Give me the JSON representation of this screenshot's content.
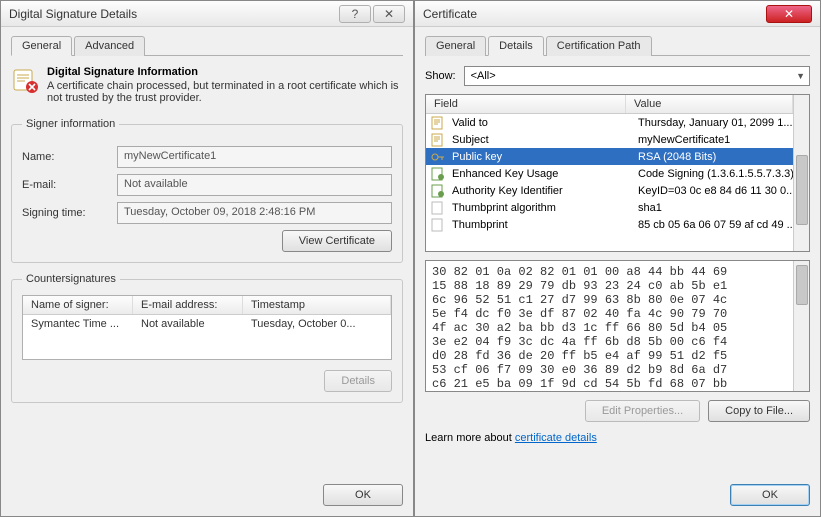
{
  "left": {
    "title": "Digital Signature Details",
    "tabs": [
      "General",
      "Advanced"
    ],
    "activeTab": 0,
    "info_title": "Digital Signature Information",
    "info_body": "A certificate chain processed, but terminated in a root certificate which is not trusted by the trust provider.",
    "signer_legend": "Signer information",
    "name_label": "Name:",
    "name_value": "myNewCertificate1",
    "email_label": "E-mail:",
    "email_value": "Not available",
    "signingtime_label": "Signing time:",
    "signingtime_value": "Tuesday,  October  09,  2018 2:48:16 PM",
    "view_cert_btn": "View Certificate",
    "counter_legend": "Countersignatures",
    "cs_headers": [
      "Name of signer:",
      "E-mail address:",
      "Timestamp"
    ],
    "cs_row": [
      "Symantec Time ...",
      "Not available",
      "Tuesday, October 0..."
    ],
    "details_btn": "Details",
    "ok_btn": "OK"
  },
  "right": {
    "title": "Certificate",
    "tabs": [
      "General",
      "Details",
      "Certification Path"
    ],
    "activeTab": 1,
    "show_label": "Show:",
    "show_value": "<All>",
    "lv_headers": [
      "Field",
      "Value"
    ],
    "rows": [
      {
        "field": "Valid to",
        "value": "Thursday, January 01, 2099 1...",
        "icon": "doc"
      },
      {
        "field": "Subject",
        "value": "myNewCertificate1",
        "icon": "doc"
      },
      {
        "field": "Public key",
        "value": "RSA (2048 Bits)",
        "icon": "key",
        "selected": true
      },
      {
        "field": "Enhanced Key Usage",
        "value": "Code Signing (1.3.6.1.5.5.7.3.3)",
        "icon": "ext"
      },
      {
        "field": "Authority Key Identifier",
        "value": "KeyID=03 0c e8 84 d6 11 30 0...",
        "icon": "ext"
      },
      {
        "field": "Thumbprint algorithm",
        "value": "sha1",
        "icon": "blank"
      },
      {
        "field": "Thumbprint",
        "value": "85 cb 05 6a 06 07 59 af cd 49 ...",
        "icon": "blank"
      }
    ],
    "hex": "30 82 01 0a 02 82 01 01 00 a8 44 bb 44 69\n15 88 18 89 29 79 db 93 23 24 c0 ab 5b e1\n6c 96 52 51 c1 27 d7 99 63 8b 80 0e 07 4c\n5e f4 dc f0 3e df 87 02 40 fa 4c 90 79 70\n4f ac 30 a2 ba bb d3 1c ff 66 80 5d b4 05\n3e e2 04 f9 3c dc 4a ff 6b d8 5b 00 c6 f4\nd0 28 fd 36 de 20 ff b5 e4 af 99 51 d2 f5\n53 cf 06 f7 09 30 e0 36 89 d2 b9 8d 6a d7\nc6 21 e5 ba 09 1f 9d cd 54 5b fd 68 07 bb",
    "edit_props_btn": "Edit Properties...",
    "copy_file_btn": "Copy to File...",
    "learn_prefix": "Learn more about ",
    "learn_link": "certificate details",
    "ok_btn": "OK"
  }
}
